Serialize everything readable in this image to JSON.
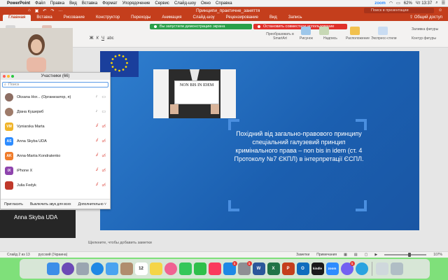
{
  "menubar": {
    "app": "PowerPoint",
    "items": [
      "Файл",
      "Правка",
      "Вид",
      "Вставка",
      "Формат",
      "Упорядочение",
      "Сервис",
      "Слайд-шоу",
      "Окно",
      "Справка"
    ],
    "battery": "62%",
    "clock": "Чт 13:37",
    "zoom_label": "zoom"
  },
  "titlebar": {
    "doc_title": "Принципи_практичне_заняття",
    "search_placeholder": "Поиск в презентации"
  },
  "ribbon_tabs": {
    "items": [
      "Главная",
      "Вставка",
      "Рисование",
      "Конструктор",
      "Переходы",
      "Анимация",
      "Слайд-шоу",
      "Рецензирование",
      "Вид",
      "Запись"
    ],
    "active_index": 0,
    "share": "Общий доступ"
  },
  "ribbon": {
    "notify_green": "Вы запустили демонстрацию экрана",
    "notify_red": "Остановить совместное использование",
    "convert_smartart": "Преобразовать в SmartArt",
    "picture": "Рисунок",
    "textbox": "Надпись",
    "arrange": "Расположение",
    "quick_styles": "Экспресс-стили",
    "fill": "Заливка фигуры",
    "outline": "Контур фигуры"
  },
  "slide": {
    "sign_text": "NON BIS IN IDEM",
    "body_text": "Похідний від загально-правового принципу спеціальний галузевий принцип кримінального права – non bis in idem (ст. 4 Протоколу №7 ЄКПЛ) в інтерпретації ЄСПЛ."
  },
  "notes_placeholder": "Щелкните, чтобы добавить заметки",
  "zoom_panel": {
    "title": "Участники (66)",
    "search_placeholder": "Поиск",
    "participants": [
      {
        "name": "Oksana Hor... (Организатор, я)",
        "initials": "",
        "color": "#8d6e63",
        "mic": "on",
        "cam": "on"
      },
      {
        "name": "Діана Кушериб",
        "initials": "",
        "color": "#9e7b6a",
        "mic": "on",
        "cam": "on"
      },
      {
        "name": "Vyniarska Marta",
        "initials": "VM",
        "color": "#f0b429",
        "mic": "off",
        "cam": "off"
      },
      {
        "name": "Anna Skyba UDA",
        "initials": "AS",
        "color": "#2d8cff",
        "mic": "off",
        "cam": "off"
      },
      {
        "name": "Anna-Mariia Kondratenko",
        "initials": "AK",
        "color": "#f07c2a",
        "mic": "off",
        "cam": "off"
      },
      {
        "name": "iPhone X",
        "initials": "iX",
        "color": "#8e44ad",
        "mic": "off",
        "cam": "off"
      },
      {
        "name": "Julia Fedyk",
        "initials": "",
        "color": "#c0392b",
        "mic": "off",
        "cam": "off"
      }
    ],
    "invite": "Пригласить",
    "mute_all": "Выключить звук для всех",
    "more": "Дополнительно"
  },
  "video_bottom_name": "Anna Skyba UDA",
  "statusbar": {
    "slide_info": "Слайд 2 из 13",
    "language": "русский (Украина)",
    "notes": "Заметки",
    "comments": "Примечания",
    "zoom_pct": "107%"
  },
  "dock": [
    {
      "name": "finder",
      "color": "#3b8ee8",
      "label": ""
    },
    {
      "name": "siri",
      "color": "#6c4ab6",
      "label": ""
    },
    {
      "name": "launchpad",
      "color": "#9aa5b1",
      "label": ""
    },
    {
      "name": "safari",
      "color": "#1e88e5",
      "label": ""
    },
    {
      "name": "mail",
      "color": "#4aa3f0",
      "label": ""
    },
    {
      "name": "contacts",
      "color": "#b08d6e",
      "label": ""
    },
    {
      "name": "calendar",
      "color": "#ffffff",
      "label": "12"
    },
    {
      "name": "notes",
      "color": "#f5d547",
      "label": ""
    },
    {
      "name": "photos",
      "color": "#f06292",
      "label": ""
    },
    {
      "name": "messages",
      "color": "#34c759",
      "label": ""
    },
    {
      "name": "facetime",
      "color": "#2fbf4a",
      "label": ""
    },
    {
      "name": "music",
      "color": "#fb3b5c",
      "label": ""
    },
    {
      "name": "app-store",
      "color": "#1e88e5",
      "label": "",
      "badge": "1"
    },
    {
      "name": "system-preferences",
      "color": "#8e8e93",
      "label": "",
      "badge": "1"
    },
    {
      "name": "word",
      "color": "#2b579a",
      "label": "W"
    },
    {
      "name": "excel",
      "color": "#217346",
      "label": "X"
    },
    {
      "name": "powerpoint",
      "color": "#c43e1c",
      "label": "P"
    },
    {
      "name": "outlook",
      "color": "#0f6cbd",
      "label": "O"
    },
    {
      "name": "kindle",
      "color": "#1a1a1a",
      "label": "kindle"
    },
    {
      "name": "zoom",
      "color": "#2d8cff",
      "label": "zoom"
    },
    {
      "name": "viber",
      "color": "#7360f2",
      "label": "",
      "badge": "1"
    },
    {
      "name": "telegram",
      "color": "#2aa3e0",
      "label": ""
    },
    {
      "name": "finder-2",
      "color": "#cfd8dc",
      "label": ""
    },
    {
      "name": "trash",
      "color": "#b0bec5",
      "label": ""
    }
  ]
}
